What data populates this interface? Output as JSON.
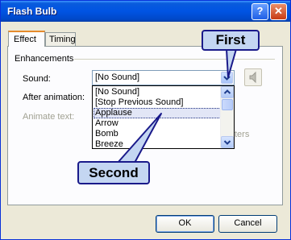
{
  "window": {
    "title": "Flash Bulb",
    "help_glyph": "?",
    "close_glyph": "✕"
  },
  "tabs": [
    {
      "label": "Effect",
      "active": true
    },
    {
      "label": "Timing",
      "active": false
    }
  ],
  "enhancements": {
    "group_label": "Enhancements",
    "sound_label": "Sound:",
    "sound_value": "[No Sound]",
    "after_animation_label": "After animation:",
    "animate_text_label": "Animate text:",
    "partial_text": "ters",
    "sound_options": [
      "[No Sound]",
      "[Stop Previous Sound]",
      "Applause",
      "Arrow",
      "Bomb",
      "Breeze"
    ],
    "highlighted_option": "Applause"
  },
  "callouts": {
    "first": "First",
    "second": "Second"
  },
  "buttons": {
    "ok": "OK",
    "cancel": "Cancel"
  },
  "colors": {
    "titlebar": "#0054e3",
    "dialog_bg": "#ece9d8",
    "tab_accent": "#e68b2c",
    "callout_fill": "#c4d6f2",
    "callout_border": "#1a1a8a"
  },
  "icons": [
    "help-icon",
    "close-icon",
    "dropdown-arrow-icon",
    "speaker-icon",
    "scroll-up-icon",
    "scroll-down-icon"
  ]
}
